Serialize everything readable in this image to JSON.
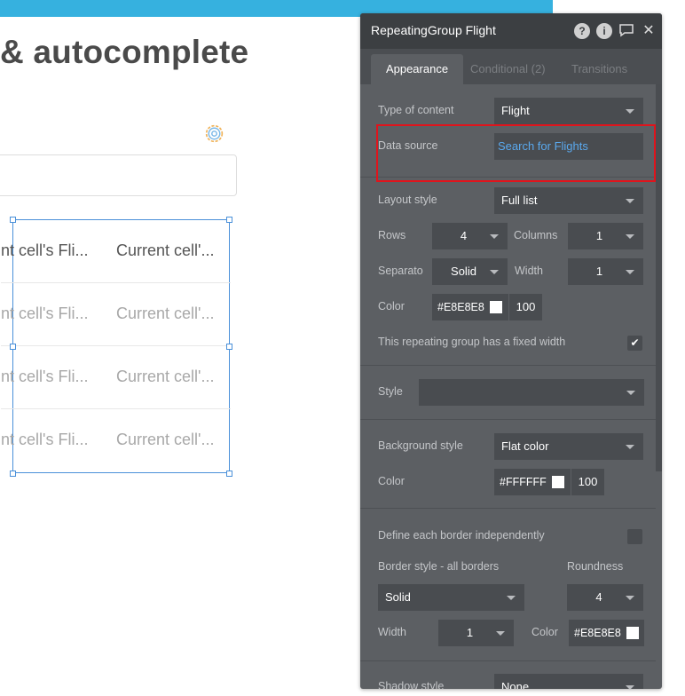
{
  "canvas": {
    "title": "& autocomplete",
    "rows": [
      {
        "a": "nt cell's Fli...",
        "b": "Current cell'..."
      },
      {
        "a": "nt cell's Fli...",
        "b": "Current cell'..."
      },
      {
        "a": "nt cell's Fli...",
        "b": "Current cell'..."
      },
      {
        "a": "nt cell's Fli...",
        "b": "Current cell'..."
      }
    ]
  },
  "panel": {
    "title": "RepeatingGroup Flight",
    "tabs": [
      "Appearance",
      "Conditional (2)",
      "Transitions"
    ],
    "type_of_content": {
      "label": "Type of content",
      "value": "Flight"
    },
    "data_source": {
      "label": "Data source",
      "value": "Search for Flights"
    },
    "layout_style": {
      "label": "Layout style",
      "value": "Full list"
    },
    "rows": {
      "label": "Rows",
      "value": "4"
    },
    "columns": {
      "label": "Columns",
      "value": "1"
    },
    "separator": {
      "label": "Separato",
      "value": "Solid"
    },
    "width": {
      "label": "Width",
      "value": "1"
    },
    "color": {
      "label": "Color",
      "hex": "#E8E8E8",
      "opacity": "100"
    },
    "fixed_width": {
      "label": "This repeating group has a fixed width",
      "checked": true
    },
    "style": {
      "label": "Style",
      "value": ""
    },
    "background_style": {
      "label": "Background style",
      "value": "Flat color"
    },
    "bg_color": {
      "label": "Color",
      "hex": "#FFFFFF",
      "opacity": "100"
    },
    "border_independent": {
      "label": "Define each border independently"
    },
    "border_style": {
      "label": "Border style - all borders",
      "value": "Solid"
    },
    "roundness": {
      "label": "Roundness",
      "value": "4"
    },
    "border_width": {
      "label": "Width",
      "value": "1"
    },
    "border_color": {
      "label": "Color",
      "hex": "#E8E8E8"
    },
    "shadow_style": {
      "label": "Shadow style",
      "value": "None"
    }
  },
  "colors": {
    "accent_blue": "#36b1df",
    "selection": "#4a90d9",
    "highlight": "#e0141c",
    "panel_bg": "#5c5f63"
  }
}
